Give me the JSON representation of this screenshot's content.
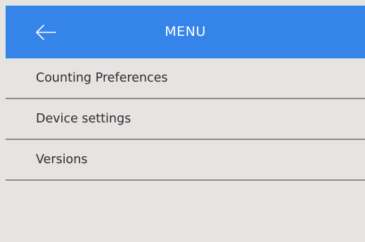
{
  "header": {
    "title": "MENU",
    "back_icon": "arrow-left-icon",
    "background_color": "#3584ea",
    "text_color": "#ffffff"
  },
  "menu": {
    "items": [
      {
        "label": "Counting Preferences"
      },
      {
        "label": "Device settings"
      },
      {
        "label": "Versions"
      }
    ]
  },
  "colors": {
    "background": "#e6e4e3",
    "divider": "#8c8c8c",
    "item_text": "#2d2d2d"
  }
}
